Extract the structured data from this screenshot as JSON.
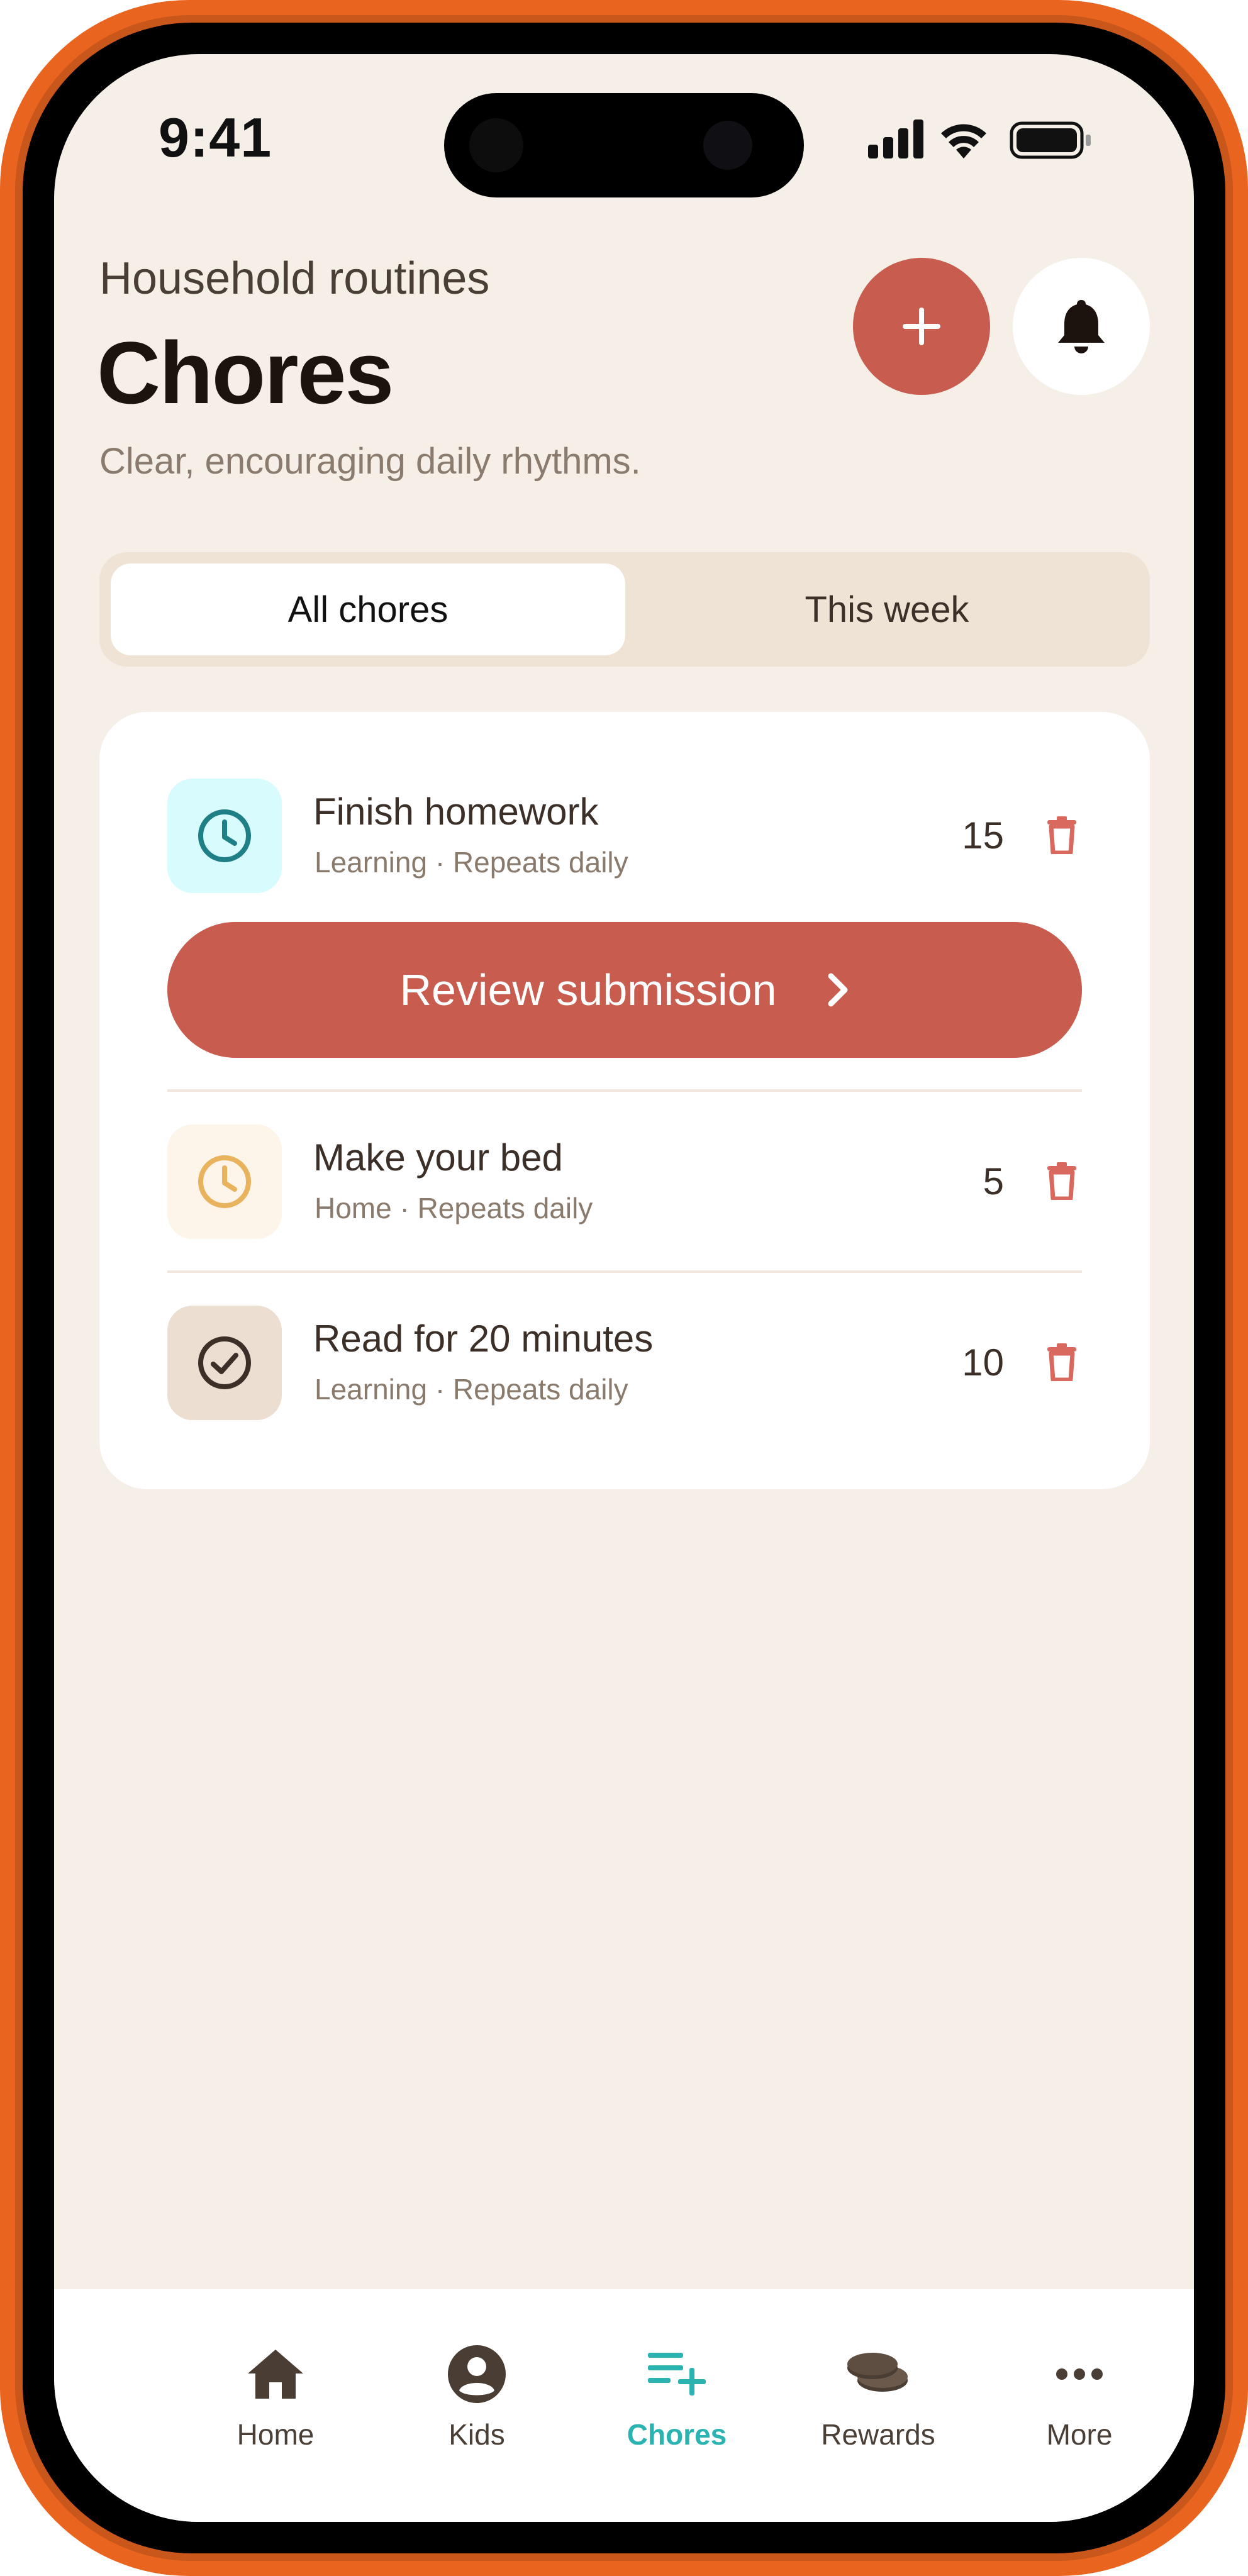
{
  "status_bar": {
    "time": "9:41"
  },
  "header": {
    "eyebrow": "Household routines",
    "title": "Chores",
    "subtitle": "Clear, encouraging daily rhythms."
  },
  "actions": {
    "add_icon": "plus-icon",
    "notifications_icon": "bell-icon"
  },
  "segments": [
    {
      "label": "All chores",
      "active": true
    },
    {
      "label": "This week",
      "active": false
    }
  ],
  "chores": [
    {
      "title": "Finish homework",
      "meta": "Learning · Repeats daily",
      "points": "15",
      "icon": "clock-icon",
      "status": "pending-review"
    },
    {
      "title": "Make your bed",
      "meta": "Home · Repeats daily",
      "points": "5",
      "icon": "clock-icon",
      "status": "pending"
    },
    {
      "title": "Read for 20 minutes",
      "meta": "Learning · Repeats daily",
      "points": "10",
      "icon": "check-circle-icon",
      "status": "done"
    }
  ],
  "review_button": {
    "label": "Review submission"
  },
  "bottom_nav": [
    {
      "label": "Home",
      "icon": "home-icon",
      "active": false
    },
    {
      "label": "Kids",
      "icon": "person-icon",
      "active": false
    },
    {
      "label": "Chores",
      "icon": "list-add-icon",
      "active": true
    },
    {
      "label": "Rewards",
      "icon": "coins-icon",
      "active": false
    },
    {
      "label": "More",
      "icon": "more-icon",
      "active": false
    }
  ],
  "colors": {
    "frame": "#e8641f",
    "background": "#f5efe8",
    "accent": "#c85c4f",
    "active_nav": "#2bb3b1",
    "icon_teal_bg": "#d8fbfd",
    "icon_amber_bg": "#fdf4ea",
    "icon_done_bg": "#ecdfd2"
  }
}
